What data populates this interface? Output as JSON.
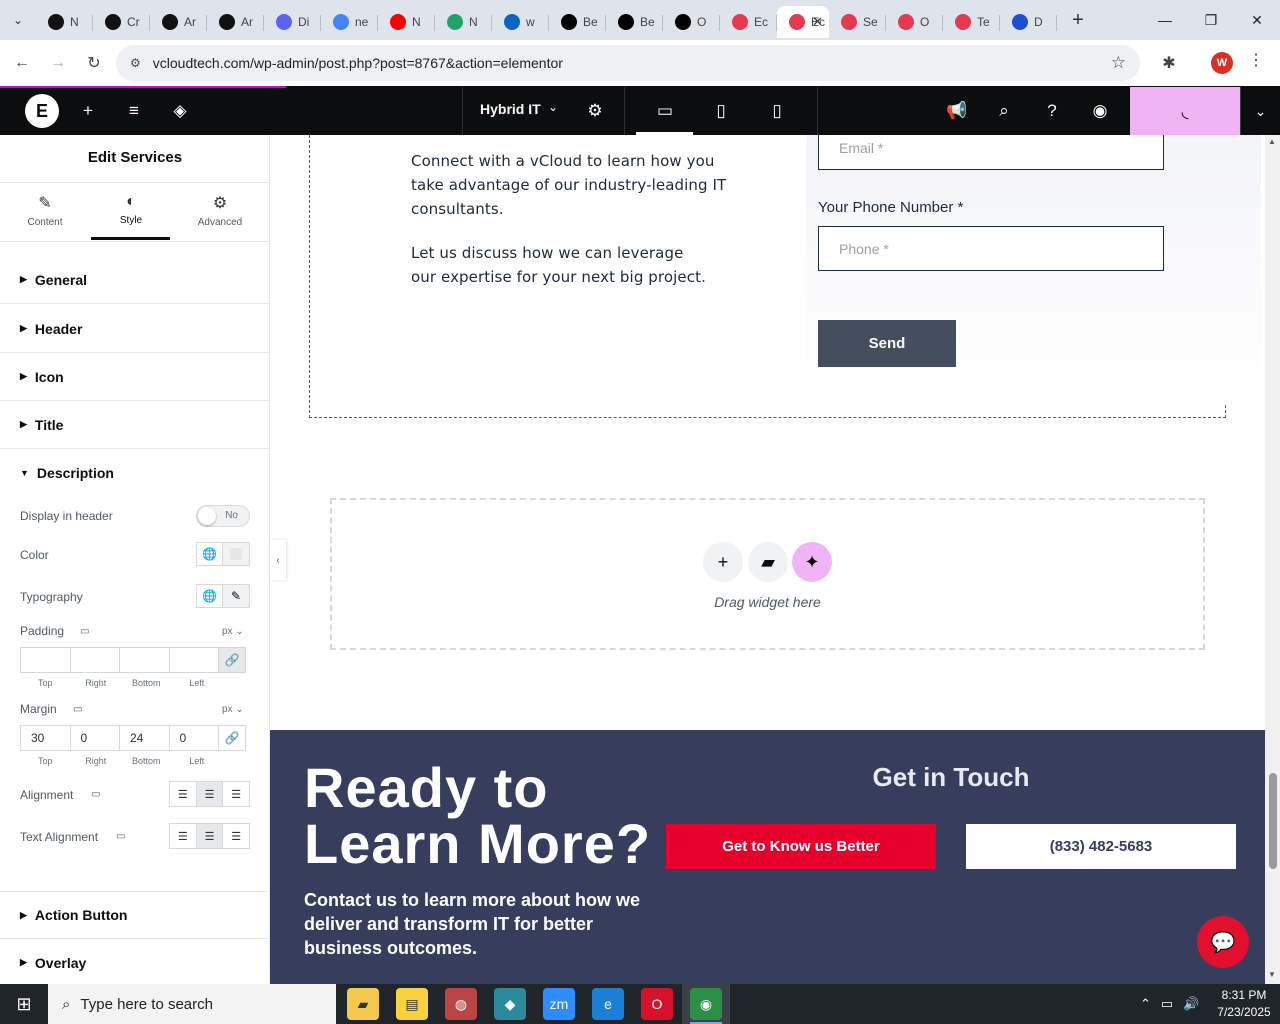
{
  "browser": {
    "tabs": [
      {
        "label": "N",
        "color": "#111"
      },
      {
        "label": "Cr",
        "color": "#111"
      },
      {
        "label": "Ar",
        "color": "#111"
      },
      {
        "label": "Ar",
        "color": "#111"
      },
      {
        "label": "Di",
        "color": "#5865f2"
      },
      {
        "label": "ne",
        "color": "#4285f4"
      },
      {
        "label": "N",
        "color": "#ff0000"
      },
      {
        "label": "N",
        "color": "#21a366"
      },
      {
        "label": "w",
        "color": "#0a66c2"
      },
      {
        "label": "Be",
        "color": "#000"
      },
      {
        "label": "Be",
        "color": "#000"
      },
      {
        "label": "O",
        "color": "#000"
      },
      {
        "label": "Ec",
        "color": "#e53950"
      },
      {
        "label": "Ec",
        "color": "#e53950",
        "active": true
      },
      {
        "label": "Se",
        "color": "#e53950"
      },
      {
        "label": "O",
        "color": "#e53950"
      },
      {
        "label": "Te",
        "color": "#e53950"
      },
      {
        "label": "D",
        "color": "#1c4fd1"
      }
    ],
    "url": "vcloudtech.com/wp-admin/post.php?post=8767&action=elementor",
    "profile_initial": "W"
  },
  "editor": {
    "page_name": "Hybrid IT",
    "panel_title": "Edit Services",
    "panel_tabs": [
      "Content",
      "Style",
      "Advanced"
    ],
    "sections_top": [
      "General",
      "Header",
      "Icon",
      "Title",
      "Description"
    ],
    "sections_bottom": [
      "Action Button",
      "Overlay"
    ],
    "controls": {
      "display_in_header": "Display in header",
      "toggle_value": "No",
      "color": "Color",
      "typography": "Typography",
      "padding": "Padding",
      "margin": "Margin",
      "alignment": "Alignment",
      "text_alignment": "Text Alignment",
      "unit": "px",
      "dim_labels": [
        "Top",
        "Right",
        "Bottom",
        "Left"
      ],
      "padding_values": [
        "",
        "",
        "",
        ""
      ],
      "margin_values": [
        "30",
        "0",
        "24",
        "0"
      ]
    }
  },
  "canvas": {
    "contact_para1": "Connect with a vCloud to learn how you take advantage of our industry-leading IT consultants.",
    "contact_para2": "Let us discuss how we can leverage our expertise for your next big project.",
    "email_placeholder": "Email *",
    "phone_label": "Your Phone Number *",
    "phone_placeholder": "Phone *",
    "send_label": "Send",
    "drop_text": "Drag widget here",
    "cta_title": "Ready to Learn More?",
    "cta_desc": "Contact us to learn more about how we deliver and transform IT for better business outcomes.",
    "get_in_touch": "Get in Touch",
    "btn_know": "Get to Know us Better",
    "btn_phone": "(833) 482-5683"
  },
  "taskbar": {
    "search_placeholder": "Type here to search",
    "time": "8:31 PM",
    "date": "7/23/2025"
  }
}
